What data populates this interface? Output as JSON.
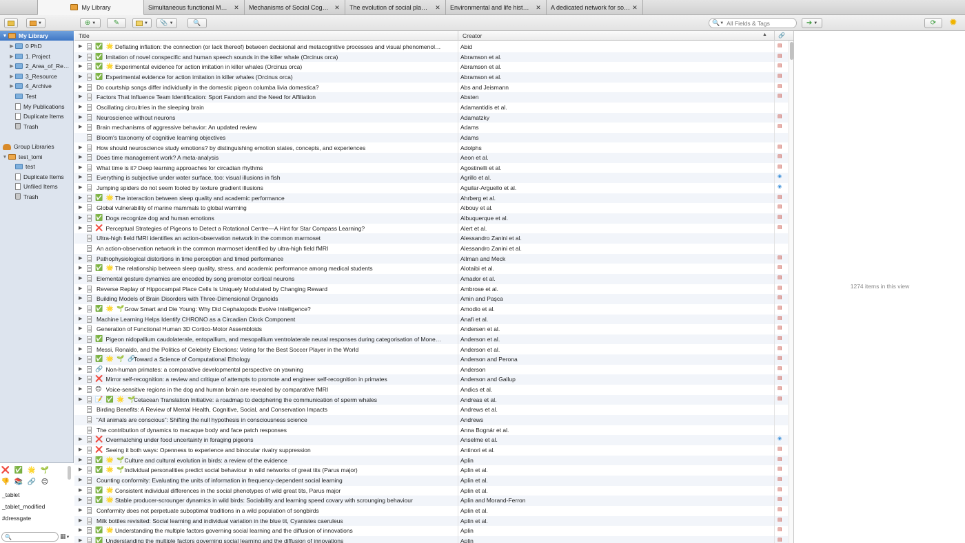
{
  "tabs": [
    {
      "label": "My Library",
      "active": true
    },
    {
      "label": "Simultaneous functional M…"
    },
    {
      "label": "Mechanisms of Social Cog…"
    },
    {
      "label": "The evolution of social pla…"
    },
    {
      "label": "Environmental and life hist…"
    },
    {
      "label": "A dedicated network for so…"
    }
  ],
  "toolbar": {
    "search_placeholder": "All Fields & Tags"
  },
  "sidebar": {
    "my_library": "My Library",
    "items": [
      "0 PhD",
      "1. Project",
      "2_Area_of_Re…",
      "3_Resource",
      "4_Archive",
      "Test",
      "My Publications",
      "Duplicate Items",
      "Trash"
    ],
    "group_libraries": "Group Libraries",
    "group_name": "test_tomi",
    "group_items": [
      "test",
      "Duplicate Items",
      "Unfiled Items",
      "Trash"
    ]
  },
  "tags": {
    "emoji_row1": [
      "❌",
      "✅",
      "🌟",
      "🌱"
    ],
    "emoji_row2": [
      "👎",
      "📚",
      "🔗",
      "😊"
    ],
    "names": [
      "_tablet",
      "_tablet_modified",
      "#dressgate"
    ]
  },
  "columns": {
    "title": "Title",
    "creator": "Creator"
  },
  "rows": [
    {
      "e": "✅ 🌟",
      "t": "Deflating inflation: the connection (or lack thereof) between decisional and metacognitive processes and visual phenomenol…",
      "c": "Abid",
      "a": "pdf"
    },
    {
      "e": "✅",
      "t": "Imitation of novel conspecific and human speech sounds in the killer whale (Orcinus orca)",
      "c": "Abramson et al.",
      "a": "pdf"
    },
    {
      "e": "✅ 🌟",
      "t": "Experimental evidence for action imitation in killer whales (Orcinus orca)",
      "c": "Abramson et al.",
      "a": "pdf"
    },
    {
      "e": "✅",
      "t": "Experimental evidence for action imitation in killer whales (Orcinus orca)",
      "c": "Abramson et al.",
      "a": "pdf"
    },
    {
      "e": "",
      "t": "Do courtship songs differ individually in the domestic pigeon columba livia domestica?",
      "c": "Abs and Jeismann",
      "a": "pdf"
    },
    {
      "e": "",
      "t": "Factors That Influence Team Identification: Sport Fandom and the Need for Affiliation",
      "c": "Absten",
      "a": "pdf"
    },
    {
      "e": "",
      "t": "Oscillating circuitries in the sleeping brain",
      "c": "Adamantidis et al.",
      "a": ""
    },
    {
      "e": "",
      "t": "Neuroscience without neurons",
      "c": "Adamatzky",
      "a": "pdf"
    },
    {
      "e": "",
      "t": "Brain mechanisms of aggressive behavior: An updated review",
      "c": "Adams",
      "a": "pdf"
    },
    {
      "e": "",
      "t": "Bloom's taxonomy of cognitive learning objectives",
      "c": "Adams",
      "a": "",
      "nt": true
    },
    {
      "e": "",
      "t": "How should neuroscience study emotions? by distinguishing emotion states, concepts, and experiences",
      "c": "Adolphs",
      "a": "pdf"
    },
    {
      "e": "",
      "t": "Does time management work? A meta-analysis",
      "c": "Aeon et al.",
      "a": "pdf"
    },
    {
      "e": "",
      "t": "What time is it? Deep learning approaches for circadian rhythms",
      "c": "Agostinelli et al.",
      "a": "pdf"
    },
    {
      "e": "",
      "t": "Everything is subjective under water surface, too: visual illusions in fish",
      "c": "Agrillo et al.",
      "a": "blue"
    },
    {
      "e": "",
      "t": "Jumping spiders do not seem fooled by texture gradient illusions",
      "c": "Aguilar-Arguello et al.",
      "a": "blue"
    },
    {
      "e": "✅ 🌟",
      "t": "The interaction between sleep quality and academic performance",
      "c": "Ahrberg et al.",
      "a": "pdf"
    },
    {
      "e": "",
      "t": "Global vulnerability of marine mammals to global warming",
      "c": "Albouy et al.",
      "a": "pdf"
    },
    {
      "e": "✅",
      "t": "Dogs recognize dog and human emotions",
      "c": "Albuquerque et al.",
      "a": "pdf"
    },
    {
      "e": "❌",
      "t": "Perceptual Strategies of Pigeons to Detect a Rotational Centre—A Hint for Star Compass Learning?",
      "c": "Alert et al.",
      "a": "pdf"
    },
    {
      "e": "",
      "t": "Ultra-high field fMRI identifies an action-observation network in the common marmoset",
      "c": "Alessandro Zanini et al.",
      "a": "",
      "nt": true
    },
    {
      "e": "",
      "t": "An action-observation network in the common marmoset identified by ultra-high field fMRI",
      "c": "Alessandro Zanini et al.",
      "a": "",
      "nt": true
    },
    {
      "e": "",
      "t": "Pathophysiological distortions in time perception and timed performance",
      "c": "Allman and Meck",
      "a": "pdf"
    },
    {
      "e": "✅ 🌟",
      "t": "The relationship between sleep quality, stress, and academic performance among medical students",
      "c": "Alotaibi et al.",
      "a": "pdf"
    },
    {
      "e": "",
      "t": "Elemental gesture dynamics are encoded by song premotor cortical neurons",
      "c": "Amador et al.",
      "a": "pdf"
    },
    {
      "e": "",
      "t": "Reverse Replay of Hippocampal Place Cells Is Uniquely Modulated by Changing Reward",
      "c": "Ambrose et al.",
      "a": "pdf"
    },
    {
      "e": "",
      "t": "Building Models of Brain Disorders with Three-Dimensional Organoids",
      "c": "Amin and Paşca",
      "a": "pdf"
    },
    {
      "e": "✅ 🌟 🌱",
      "t": "Grow Smart and Die Young: Why Did Cephalopods Evolve Intelligence?",
      "c": "Amodio et al.",
      "a": "pdf"
    },
    {
      "e": "",
      "t": "Machine Learning Helps Identify CHRONO as a Circadian Clock Component",
      "c": "Anafi et al.",
      "a": "pdf"
    },
    {
      "e": "",
      "t": "Generation of Functional Human 3D Cortico-Motor Assembloids",
      "c": "Andersen et al.",
      "a": "pdf"
    },
    {
      "e": "✅",
      "t": "Pigeon nidopallium caudolaterale, entopallium, and mesopallium ventrolaterale neural responses during categorisation of Mone…",
      "c": "Anderson et al.",
      "a": "pdf"
    },
    {
      "e": "",
      "t": "Messi, Ronaldo, and the Politics of Celebrity Elections: Voting for the Best Soccer Player in the World",
      "c": "Anderson et al.",
      "a": "pdf"
    },
    {
      "e": "✅ 🌟 🌱 🔗",
      "t": "Toward a Science of Computational Ethology",
      "c": "Anderson and Perona",
      "a": "pdf"
    },
    {
      "e": "🔗",
      "t": "Non-human primates: a comparative developmental perspective on yawning",
      "c": "Anderson",
      "a": "pdf"
    },
    {
      "e": "❌",
      "t": "Mirror self-recognition: a review and critique of attempts to promote and engineer self-recognition in primates",
      "c": "Anderson and Gallup",
      "a": "pdf"
    },
    {
      "e": "😊",
      "t": "Voice-sensitive regions in the dog and human brain are revealed by comparative fMRI",
      "c": "Andics et al.",
      "a": "pdf"
    },
    {
      "e": "📝 ✅ 🌟 🌱",
      "t": "Cetacean Translation Initiative: a roadmap to deciphering the communication of sperm whales",
      "c": "Andreas et al.",
      "a": "pdf"
    },
    {
      "e": "",
      "t": "Birding Benefits: A Review of Mental Health, Cognitive, Social, and Conservation Impacts",
      "c": "Andrews et al.",
      "a": "",
      "nt": true
    },
    {
      "e": "",
      "t": "“All animals are conscious”: Shifting the null hypothesis in consciousness science",
      "c": "Andrews",
      "a": "",
      "nt": true
    },
    {
      "e": "",
      "t": "The contribution of dynamics to macaque body and face patch responses",
      "c": "Anna Bognár et al.",
      "a": "",
      "nt": true
    },
    {
      "e": "❌",
      "t": "Overmatching under food uncertainty in foraging pigeons",
      "c": "Anselme et al.",
      "a": "blue"
    },
    {
      "e": "❌",
      "t": "Seeing it both ways: Openness to experience and binocular rivalry suppression",
      "c": "Antinori et al.",
      "a": "pdf"
    },
    {
      "e": "✅ 🌟 🌱",
      "t": "Culture and cultural evolution in birds: a review of the evidence",
      "c": "Aplin",
      "a": "pdf"
    },
    {
      "e": "✅ 🌟 🌱",
      "t": "Individual personalities predict social behaviour in wild networks of great tits (Parus major)",
      "c": "Aplin et al.",
      "a": "pdf"
    },
    {
      "e": "",
      "t": "Counting conformity: Evaluating the units of information in frequency-dependent social learning",
      "c": "Aplin et al.",
      "a": "pdf"
    },
    {
      "e": "✅ 🌟",
      "t": "Consistent individual differences in the social phenotypes of wild great tits, Parus major",
      "c": "Aplin et al.",
      "a": "pdf"
    },
    {
      "e": "✅ 🌟",
      "t": "Stable producer-scrounger dynamics in wild birds: Sociability and learning speed covary with scrounging behaviour",
      "c": "Aplin and Morand-Ferron",
      "a": "pdf"
    },
    {
      "e": "",
      "t": "Conformity does not perpetuate suboptimal traditions in a wild population of songbirds",
      "c": "Aplin et al.",
      "a": "pdf"
    },
    {
      "e": "",
      "t": "Milk bottles revisited: Social learning and individual variation in the blue tit, Cyanistes caeruleus",
      "c": "Aplin et al.",
      "a": "pdf"
    },
    {
      "e": "✅ 🌟",
      "t": "Understanding the multiple factors governing social learning and the diffusion of innovations",
      "c": "Aplin",
      "a": "pdf"
    },
    {
      "e": "✅",
      "t": "Understanding the multiple factors governing social learning and the diffusion of innovations",
      "c": "Aplin",
      "a": "pdf"
    }
  ],
  "status": {
    "count": "1274 items in this view"
  }
}
